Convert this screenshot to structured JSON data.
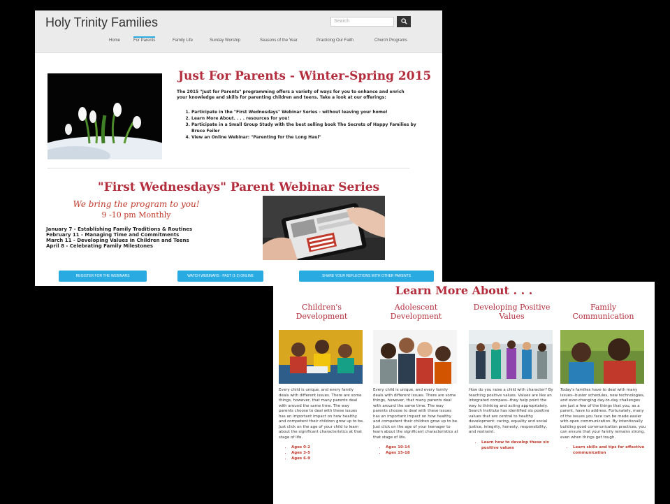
{
  "site": {
    "title": "Holy Trinity Families",
    "search_placeholder": "Search",
    "search_icon": "magnifier-icon"
  },
  "nav": [
    "Home",
    "For Parents",
    "Family Life",
    "Sunday Worship",
    "Seasons of the Year",
    "Practicing Our Faith",
    "Church Programs"
  ],
  "parents": {
    "heading": "Just For Parents - Winter-Spring 2015",
    "intro": "The 2015 \"Just for Parents\" programming offers a variety of ways for you to enhance and enrich your knowledge and skills for parenting children and teens. Take a look at our offerings:",
    "offerings": [
      "Participate in the \"First Wednesdays\" Webinar Series - without leaving your home!",
      "Learn More About. . . . resources for you!",
      "Participate in a Small Group Study with the best selling book The Secrets of Happy Families by Bruce Feiler",
      "View an Online Webinar: \"Parenting for the Long Haul\""
    ]
  },
  "webinar": {
    "heading": "\"First Wednesdays\" Parent Webinar Series",
    "tagline": "We bring the program to you!",
    "time": "9 -10 pm Monthly",
    "dates": [
      "January 7 - Establishing Family Traditions & Routines",
      "February 11 - Managing Time and Commitments",
      "March 11 - Developing Values in Children and Teens",
      "April 8 - Celebrating Family Milestones"
    ],
    "buttons": [
      "REGISTER FOR THE WEBINARS",
      "WATCH WEBINARS - PAST (1-3) ONLINE",
      "SHARE YOUR REFLECTIONS WITH OTHER PARENTS"
    ]
  },
  "learn_more": {
    "heading": "Learn More About . . .",
    "columns": [
      {
        "title": "Children's Development",
        "text": "Every child is unique, and every family deals with different issues. There are some things, however, that many parents deal with around the same time. The way parents choose to deal with these issues has an important impact on how healthy and competent their children grow up to be. Just click on the age of your child to learn about the significant characteristics at that stage of life.",
        "links": [
          "Ages 0-2",
          "Ages 3-5",
          "Ages 6-9"
        ]
      },
      {
        "title": "Adolescent Development",
        "text": "Every child is unique, and every family deals with different issues. There are some things, however, that many parents deal with around the same time. The way parents choose to deal with these issues has an important impact on how healthy and competent their children grow up to be. Just click on the age of your teenager to learn about the significant characteristics at that stage of life.",
        "links": [
          "Ages 10-14",
          "Ages 15-18"
        ]
      },
      {
        "title": "Developing Positive Values",
        "text": "How do you raise a child with character? By teaching positive values. Values are like an integrated compass--they help point the way to thinking and acting appropriately. Search Institute has identified six positive values that are central to healthy development: caring, equality and social justice, integrity, honesty, responsibility, and restraint.",
        "links": [
          "Learn how to develop these six positive values"
        ]
      },
      {
        "title": "Family Communication",
        "text": "Today's families have to deal with many issues--busier schedules, new technologies, and ever-changing day-to-day challenges are just a few of the things that you, as a parent, have to address. Fortunately, many of the issues you face can be made easier with open communication. By intentionally building good communication practices, you can ensure that your family remains strong, even when things get tough.",
        "links": [
          "Learn skills and tips for effective communication"
        ]
      }
    ]
  },
  "colors": {
    "accent": "#b32d3d",
    "button": "#29abe2",
    "nav_active": "#29abe2"
  }
}
